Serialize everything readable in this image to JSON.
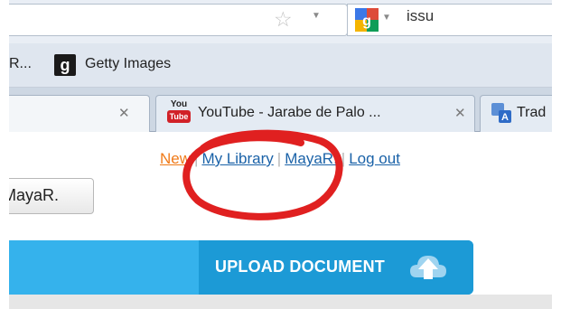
{
  "toolbar": {
    "search_text": "issu"
  },
  "bookmarks": {
    "prev_item": "R...",
    "getty_icon_letter": "g",
    "getty_label": "Getty Images"
  },
  "tabs": [
    {
      "label": ""
    },
    {
      "label": "YouTube - Jarabe de Palo ...",
      "icon_top": "You",
      "icon_bottom": "Tube"
    },
    {
      "label": "Trad"
    }
  ],
  "page": {
    "links": {
      "new": "New",
      "my_library": "My Library",
      "user": "MayaR.",
      "logout": "Log out"
    },
    "user_chip": "MayaR.",
    "upload_label": "UPLOAD DOCUMENT"
  },
  "colors": {
    "upload_blue": "#1c9ad6",
    "link_blue": "#1a62a8",
    "new_orange": "#f07a18",
    "annotation_red": "#e02020"
  }
}
